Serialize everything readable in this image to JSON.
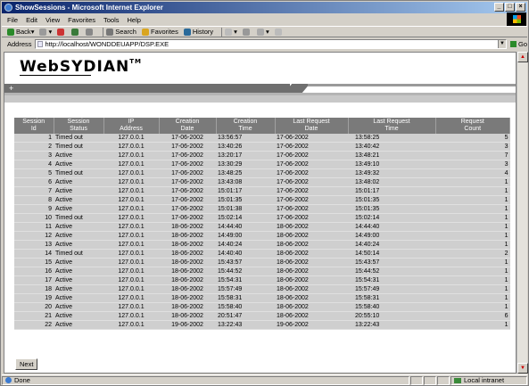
{
  "window": {
    "title": "ShowSessions - Microsoft Internet Explorer"
  },
  "menu": [
    "File",
    "Edit",
    "View",
    "Favorites",
    "Tools",
    "Help"
  ],
  "toolbar": {
    "back": "Back",
    "search": "Search",
    "favorites": "Favorites",
    "history": "History"
  },
  "address": {
    "label": "Address",
    "value": "http://localhost/WONDDEUAPP/DSP.EXE",
    "go": "Go"
  },
  "logo": {
    "text": "WebSYDIAN",
    "tm": "TM"
  },
  "nav": {
    "plus": "+"
  },
  "table": {
    "headers": [
      [
        "Session",
        "Id"
      ],
      [
        "Session",
        "Status"
      ],
      [
        "IP",
        "Address"
      ],
      [
        "Creation",
        "Date"
      ],
      [
        "Creation",
        "Time"
      ],
      [
        "Last Request",
        "Date"
      ],
      [
        "Last Request",
        "Time"
      ],
      [
        "Request",
        "Count"
      ]
    ],
    "rows": [
      [
        "1",
        "Timed out",
        "127.0.0.1",
        "17-06-2002",
        "13:56:57",
        "17-06-2002",
        "13:58:25",
        "5"
      ],
      [
        "2",
        "Timed out",
        "127.0.0.1",
        "17-06-2002",
        "13:40:26",
        "17-06-2002",
        "13:40:42",
        "3"
      ],
      [
        "3",
        "Active",
        "127.0.0.1",
        "17-06-2002",
        "13:20:17",
        "17-06-2002",
        "13:48:21",
        "7"
      ],
      [
        "4",
        "Active",
        "127.0.0.1",
        "17-06-2002",
        "13:30:29",
        "17-06-2002",
        "13:49:10",
        "3"
      ],
      [
        "5",
        "Timed out",
        "127.0.0.1",
        "17-06-2002",
        "13:48:25",
        "17-06-2002",
        "13:49:32",
        "4"
      ],
      [
        "6",
        "Active",
        "127.0.0.1",
        "17-06-2002",
        "13:43:08",
        "17-06-2002",
        "13:48:02",
        "1"
      ],
      [
        "7",
        "Active",
        "127.0.0.1",
        "17-06-2002",
        "15:01:17",
        "17-06-2002",
        "15:01:17",
        "1"
      ],
      [
        "8",
        "Active",
        "127.0.0.1",
        "17-06-2002",
        "15:01:35",
        "17-06-2002",
        "15:01:35",
        "1"
      ],
      [
        "9",
        "Active",
        "127.0.0.1",
        "17-06-2002",
        "15:01:38",
        "17-06-2002",
        "15:01:35",
        "1"
      ],
      [
        "10",
        "Timed out",
        "127.0.0.1",
        "17-06-2002",
        "15:02:14",
        "17-06-2002",
        "15:02:14",
        "1"
      ],
      [
        "11",
        "Active",
        "127.0.0.1",
        "18-06-2002",
        "14:44:40",
        "18-06-2002",
        "14:44:40",
        "1"
      ],
      [
        "12",
        "Active",
        "127.0.0.1",
        "18-06-2002",
        "14:49:00",
        "18-06-2002",
        "14:49:00",
        "1"
      ],
      [
        "13",
        "Active",
        "127.0.0.1",
        "18-06-2002",
        "14:40:24",
        "18-06-2002",
        "14:40:24",
        "1"
      ],
      [
        "14",
        "Timed out",
        "127.0.0.1",
        "18-06-2002",
        "14:40:40",
        "18-06-2002",
        "14:50:14",
        "2"
      ],
      [
        "15",
        "Active",
        "127.0.0.1",
        "18-06-2002",
        "15:43:57",
        "18-06-2002",
        "15:43:57",
        "1"
      ],
      [
        "16",
        "Active",
        "127.0.0.1",
        "18-06-2002",
        "15:44:52",
        "18-06-2002",
        "15:44:52",
        "1"
      ],
      [
        "17",
        "Active",
        "127.0.0.1",
        "18-06-2002",
        "15:54:31",
        "18-06-2002",
        "15:54:31",
        "1"
      ],
      [
        "18",
        "Active",
        "127.0.0.1",
        "18-06-2002",
        "15:57:49",
        "18-06-2002",
        "15:57:49",
        "1"
      ],
      [
        "19",
        "Active",
        "127.0.0.1",
        "18-06-2002",
        "15:58:31",
        "18-06-2002",
        "15:58:31",
        "1"
      ],
      [
        "20",
        "Active",
        "127.0.0.1",
        "18-06-2002",
        "15:58:40",
        "18-06-2002",
        "15:58:40",
        "1"
      ],
      [
        "21",
        "Active",
        "127.0.0.1",
        "18-06-2002",
        "20:51:47",
        "18-06-2002",
        "20:55:10",
        "6"
      ],
      [
        "22",
        "Active",
        "127.0.0.1",
        "19-06-2002",
        "13:22:43",
        "19-06-2002",
        "13:22:43",
        "1"
      ]
    ]
  },
  "next_button": "Next",
  "status": {
    "text": "Done",
    "zone": "Local intranet"
  }
}
